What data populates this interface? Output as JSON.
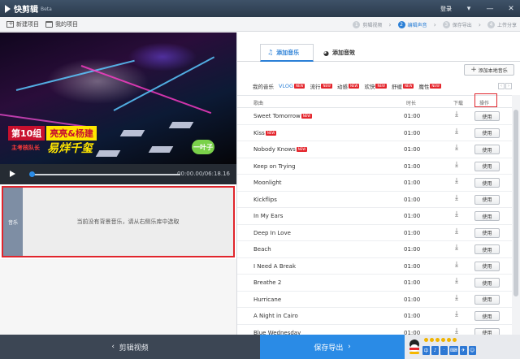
{
  "app": {
    "name": "快剪辑",
    "badge": "Beta",
    "login": "登录"
  },
  "toolbar": {
    "new_project": "新建项目",
    "my_projects": "我的项目"
  },
  "steps": [
    {
      "num": "1",
      "label": "剪辑视频",
      "active": false
    },
    {
      "num": "2",
      "label": "编辑声音",
      "active": true
    },
    {
      "num": "3",
      "label": "保存导出",
      "active": false
    },
    {
      "num": "4",
      "label": "上传分享",
      "active": false
    }
  ],
  "video": {
    "caption_group": "第10组",
    "caption_names": "亮亮&杨建",
    "caption_role": "主考核队长",
    "caption_slogan": "易烊千玺",
    "caption_brand": "一叶子"
  },
  "player": {
    "time": "00:00.00/06:18.16",
    "progress": 0.0
  },
  "music_panel": {
    "label": "音乐",
    "empty_message": "当前没有背景音乐，请从右侧乐库中选取"
  },
  "tabs": [
    {
      "label": "添加音乐",
      "icon": "music-note-icon",
      "active": true
    },
    {
      "label": "添加音效",
      "icon": "sound-effect-icon",
      "active": false
    }
  ],
  "add_local": "添加本地音乐",
  "categories": [
    {
      "label": "我的音乐",
      "new": false,
      "active": false
    },
    {
      "label": "VLOG",
      "new": true,
      "active": true
    },
    {
      "label": "流行",
      "new": true,
      "active": false
    },
    {
      "label": "动感",
      "new": true,
      "active": false
    },
    {
      "label": "欢快",
      "new": true,
      "active": false
    },
    {
      "label": "舒缓",
      "new": true,
      "active": false
    },
    {
      "label": "魔性",
      "new": true,
      "active": false
    }
  ],
  "new_badge": "NEW",
  "table": {
    "headers": {
      "song": "歌曲",
      "duration": "时长",
      "download": "下载",
      "action": "操作"
    },
    "use_label": "使用",
    "rows": [
      {
        "name": "Sweet Tomorrow",
        "new": true,
        "duration": "01:00"
      },
      {
        "name": "Kiss",
        "new": true,
        "duration": "01:00"
      },
      {
        "name": "Nobody Knows",
        "new": true,
        "duration": "01:00"
      },
      {
        "name": "Keep on Trying",
        "new": false,
        "duration": "01:00"
      },
      {
        "name": "Moonlight",
        "new": false,
        "duration": "01:00"
      },
      {
        "name": "Kickflips",
        "new": false,
        "duration": "01:00"
      },
      {
        "name": "In My Ears",
        "new": false,
        "duration": "01:00"
      },
      {
        "name": "Deep In Love",
        "new": false,
        "duration": "01:00"
      },
      {
        "name": "Beach",
        "new": false,
        "duration": "01:00"
      },
      {
        "name": "I Need A Break",
        "new": false,
        "duration": "01:00"
      },
      {
        "name": "Breathe 2",
        "new": false,
        "duration": "01:00"
      },
      {
        "name": "Hurricane",
        "new": false,
        "duration": "01:00"
      },
      {
        "name": "A Night in Cairo",
        "new": false,
        "duration": "01:00"
      },
      {
        "name": "Blue Wednesday",
        "new": false,
        "duration": "01:00"
      }
    ]
  },
  "footer": {
    "back": "剪辑视频",
    "next": "保存导出"
  },
  "ime": {
    "keys": [
      "中",
      "♪",
      "·",
      "⌨",
      "✈",
      "☺"
    ]
  }
}
